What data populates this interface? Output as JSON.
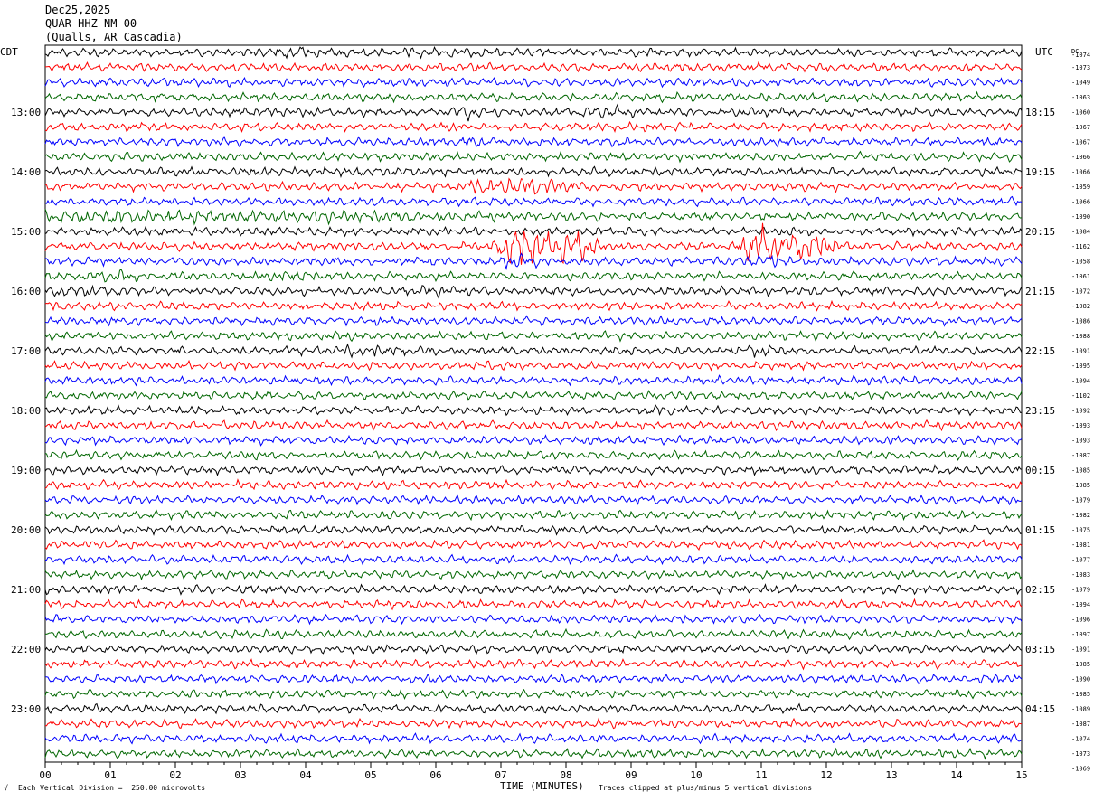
{
  "header": {
    "date": "Dec25,2025",
    "station": "QUAR HHZ NM 00",
    "location": "(Qualls, AR Cascadia)"
  },
  "footer": {
    "mark": "√",
    "vertical_division": "Each Vertical Division =  250.00 microvolts",
    "clip_note": "Traces clipped at plus/minus 5 vertical divisions"
  },
  "chart_data": {
    "type": "line",
    "title": "",
    "left_axis_label": "CDT",
    "right_axis_label": "UTC",
    "right_offset_header": "DC",
    "xlabel": "TIME (MINUTES)",
    "x_ticks": [
      "00",
      "01",
      "02",
      "03",
      "04",
      "05",
      "06",
      "07",
      "08",
      "09",
      "10",
      "11",
      "12",
      "13",
      "14",
      "15"
    ],
    "xlim": [
      0,
      15
    ],
    "trace_minutes": 15,
    "trace_count": 48,
    "trace_colors": [
      "#000000",
      "#ff0000",
      "#0000ff",
      "#006600"
    ],
    "left_hour_labels": [
      {
        "trace": 4,
        "label": "13:00"
      },
      {
        "trace": 8,
        "label": "14:00"
      },
      {
        "trace": 12,
        "label": "15:00"
      },
      {
        "trace": 16,
        "label": "16:00"
      },
      {
        "trace": 20,
        "label": "17:00"
      },
      {
        "trace": 24,
        "label": "18:00"
      },
      {
        "trace": 28,
        "label": "19:00"
      },
      {
        "trace": 32,
        "label": "20:00"
      },
      {
        "trace": 36,
        "label": "21:00"
      },
      {
        "trace": 40,
        "label": "22:00"
      },
      {
        "trace": 44,
        "label": "23:00"
      }
    ],
    "right_time_labels": [
      {
        "trace": 4,
        "label": "18:15"
      },
      {
        "trace": 8,
        "label": "19:15"
      },
      {
        "trace": 12,
        "label": "20:15"
      },
      {
        "trace": 16,
        "label": "21:15"
      },
      {
        "trace": 20,
        "label": "22:15"
      },
      {
        "trace": 24,
        "label": "23:15"
      },
      {
        "trace": 28,
        "label": "00:15"
      },
      {
        "trace": 32,
        "label": "01:15"
      },
      {
        "trace": 36,
        "label": "02:15"
      },
      {
        "trace": 40,
        "label": "03:15"
      },
      {
        "trace": 44,
        "label": "04:15"
      }
    ],
    "dc_offsets": [
      "-1074",
      "-1073",
      "-1049",
      "-1063",
      "-1060",
      "-1067",
      "-1067",
      "-1066",
      "-1066",
      "-1059",
      "-1066",
      "-1090",
      "-1084",
      "-1162",
      "-1058",
      "-1061",
      "-1072",
      "-1082",
      "-1086",
      "-1088",
      "-1091",
      "-1095",
      "-1094",
      "-1102",
      "-1092",
      "-1093",
      "-1093",
      "-1087",
      "-1085",
      "-1085",
      "-1079",
      "-1082",
      "-1075",
      "-1081",
      "-1077",
      "-1083",
      "-1079",
      "-1094",
      "-1096",
      "-1097",
      "-1091",
      "-1085",
      "-1090",
      "-1085",
      "-1089",
      "-1087",
      "-1074",
      "-1073",
      "-1069"
    ],
    "events": [
      {
        "trace": 0,
        "minute": 4.0,
        "width": 0.6,
        "amp": 1.6
      },
      {
        "trace": 0,
        "minute": 6.0,
        "width": 0.5,
        "amp": 1.5
      },
      {
        "trace": 4,
        "minute": 6.45,
        "width": 0.25,
        "amp": 2.0
      },
      {
        "trace": 4,
        "minute": 8.6,
        "width": 0.3,
        "amp": 1.8
      },
      {
        "trace": 6,
        "minute": 6.5,
        "width": 0.2,
        "amp": 1.6
      },
      {
        "trace": 9,
        "minute": 6.7,
        "width": 0.6,
        "amp": 1.8
      },
      {
        "trace": 9,
        "minute": 7.5,
        "width": 0.6,
        "amp": 2.6
      },
      {
        "trace": 11,
        "minute": 2.0,
        "width": 3.5,
        "amp": 1.8
      },
      {
        "trace": 13,
        "minute": 7.3,
        "width": 0.35,
        "amp": 5.0
      },
      {
        "trace": 13,
        "minute": 8.05,
        "width": 0.35,
        "amp": 5.0
      },
      {
        "trace": 13,
        "minute": 11.0,
        "width": 0.25,
        "amp": 6.0
      },
      {
        "trace": 13,
        "minute": 11.7,
        "width": 0.35,
        "amp": 4.0
      },
      {
        "trace": 14,
        "minute": 7.3,
        "width": 0.3,
        "amp": 2.0
      },
      {
        "trace": 14,
        "minute": 11.0,
        "width": 0.2,
        "amp": 2.0
      },
      {
        "trace": 15,
        "minute": 1.0,
        "width": 0.4,
        "amp": 1.6
      },
      {
        "trace": 15,
        "minute": 3.8,
        "width": 0.3,
        "amp": 1.6
      },
      {
        "trace": 16,
        "minute": 0.5,
        "width": 0.6,
        "amp": 1.6
      },
      {
        "trace": 16,
        "minute": 5.8,
        "width": 0.4,
        "amp": 1.5
      },
      {
        "trace": 20,
        "minute": 5.0,
        "width": 0.5,
        "amp": 1.8
      },
      {
        "trace": 20,
        "minute": 10.9,
        "width": 0.25,
        "amp": 1.8
      },
      {
        "trace": 24,
        "minute": 9.5,
        "width": 0.5,
        "amp": 1.3
      }
    ]
  }
}
